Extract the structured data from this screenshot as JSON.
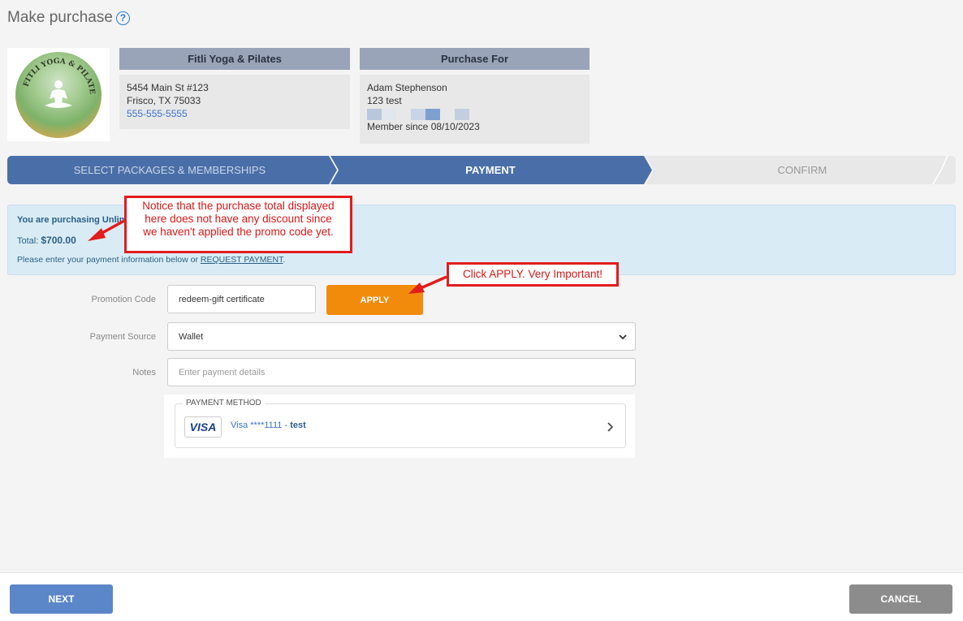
{
  "page": {
    "title": "Make purchase",
    "help_icon": "?"
  },
  "studio": {
    "logo_icon": "yoga-logo-icon",
    "name": "Fitli Yoga & Pilates",
    "address1": "5454 Main St #123",
    "address2": "Frisco, TX 75033",
    "phone": "555-555-5555"
  },
  "purchase_for": {
    "heading": "Purchase For",
    "name": "Adam Stephenson",
    "line2": "123 test",
    "member_since": "Member since 08/10/2023",
    "swatch_colors": [
      "#b9c7dd",
      "#e2e6ee",
      "#e8e8e8",
      "#c9d4e6",
      "#7f9fd0",
      "#e8e8e8",
      "#c3cfe0"
    ]
  },
  "stepper": {
    "steps": [
      "SELECT PACKAGES & MEMBERSHIPS",
      "PAYMENT",
      "CONFIRM"
    ],
    "active_index": 1,
    "colors": {
      "done": "#4a6fa8",
      "active": "#4a6fa8",
      "todo": "#e8e8e8"
    }
  },
  "banner": {
    "purchasing": "You are purchasing Unlim",
    "total_label": "Total:",
    "total_value": "$700.00",
    "pay_text": "Please enter your payment information below or",
    "request_link": "REQUEST PAYMENT",
    "pay_suffix": "."
  },
  "form": {
    "promo_label": "Promotion Code",
    "promo_value": "redeem-gift certificate",
    "apply_label": "APPLY",
    "source_label": "Payment Source",
    "source_value": "Wallet",
    "notes_label": "Notes",
    "notes_placeholder": "Enter payment details"
  },
  "payment_method": {
    "legend": "PAYMENT METHOD",
    "brand": "VISA",
    "card_number": "Visa ****1111 -",
    "card_name": "test"
  },
  "footer": {
    "next_label": "NEXT",
    "cancel_label": "CANCEL"
  },
  "annotations": {
    "note1": [
      "Notice that the purchase total displayed",
      "here does not have any discount since",
      "we haven't applied the promo code yet."
    ],
    "note2": "Click APPLY. Very Important!"
  },
  "colors": {
    "accent": "#4a6fa8",
    "apply": "#f28b0c",
    "callout": "#e31c1c"
  }
}
